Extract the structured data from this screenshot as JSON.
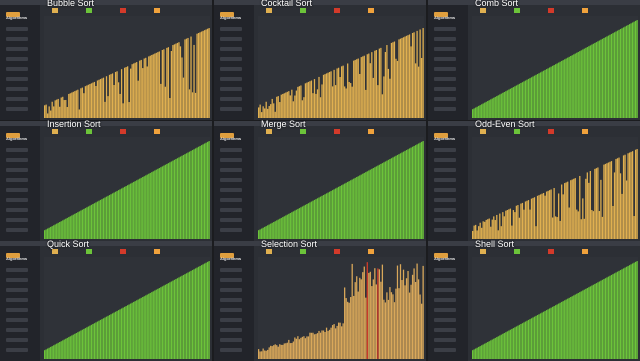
{
  "panels": [
    {
      "title": "Bubble Sort",
      "pattern": "mixed",
      "color": "#e0b050"
    },
    {
      "title": "Cocktail Sort",
      "pattern": "mixed",
      "color": "#e0b050"
    },
    {
      "title": "Comb Sort",
      "pattern": "sorted",
      "color": "#6cc43a"
    },
    {
      "title": "Insertion Sort",
      "pattern": "sorted",
      "color": "#6cc43a"
    },
    {
      "title": "Merge Sort",
      "pattern": "sorted",
      "color": "#6cc43a"
    },
    {
      "title": "Odd-Even Sort",
      "pattern": "mixed",
      "color": "#e0b050"
    },
    {
      "title": "Quick Sort",
      "pattern": "sorted",
      "color": "#6cc43a"
    },
    {
      "title": "Selection Sort",
      "pattern": "selection",
      "color": "#d9a85a"
    },
    {
      "title": "Shell Sort",
      "pattern": "sorted",
      "color": "#6cc43a"
    }
  ],
  "sidebar": {
    "title": "Algorithms"
  },
  "colors": {
    "unsorted": "#e0b050",
    "sorted": "#6cc43a",
    "comparing": "#d33a2a",
    "swapped": "#f0a23c"
  },
  "legend_icons": [
    "unsorted-swatch",
    "sorted-swatch",
    "comparing-swatch",
    "swapped-swatch"
  ]
}
